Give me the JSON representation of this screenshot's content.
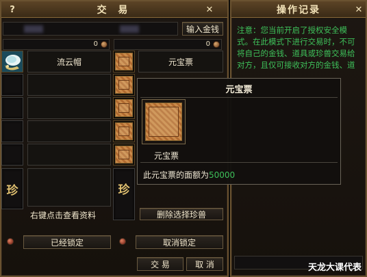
{
  "trade": {
    "title": "交 易",
    "help_glyph": "?",
    "close_glyph": "✕",
    "input_money_label": "输入金钱",
    "my_money": "0",
    "other_money": "0",
    "my_items": [
      "流云帽",
      "",
      "",
      "",
      ""
    ],
    "other_items": [
      "元宝票"
    ],
    "rare_label": "珍",
    "hint": "右键点击查看资料",
    "remove_rare_label": "删除选择珍兽",
    "locked_label": "已经锁定",
    "cancel_lock_label": "取消锁定",
    "trade_label": "交 易",
    "cancel_label": "取 消"
  },
  "log": {
    "title": "操作记录",
    "close_glyph": "✕",
    "text": "注意：您当前开启了授权安全模式。在此模式下进行交易时，不可将自己的金钱、道具或珍兽交易给对方，且仅可接收对方的金钱、道具"
  },
  "tooltip": {
    "title": "元宝票",
    "item_name": "元宝票",
    "desc_prefix": "此元宝票的面额为",
    "desc_value": "50000"
  },
  "watermark": "天龙大课代表",
  "colors": {
    "log_text": "#3ec05a",
    "value_green": "#3ec05a",
    "frame_gold": "#6a5230"
  }
}
